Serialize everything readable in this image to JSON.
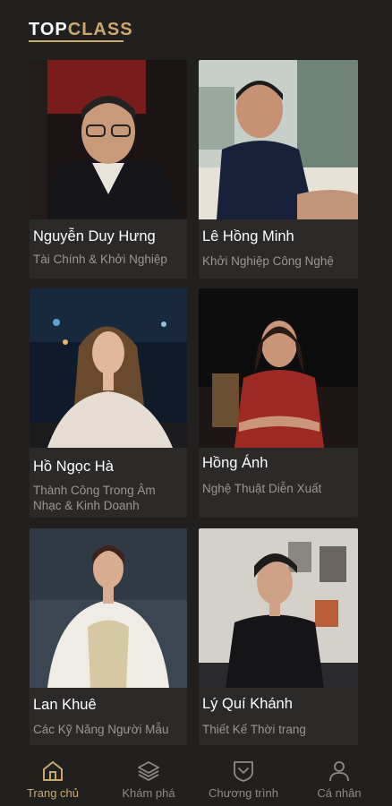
{
  "brand": {
    "logo_top": "TOP",
    "logo_class": "CLASS"
  },
  "cards": [
    {
      "name": "Nguyễn Duy Hưng",
      "topic": "Tài Chính & Khởi Nghiệp"
    },
    {
      "name": "Lê Hồng Minh",
      "topic": "Khởi Nghiệp  Công Nghệ"
    },
    {
      "name": "Hồ Ngọc Hà",
      "topic": "Thành Công Trong Âm Nhạc & Kinh Doanh"
    },
    {
      "name": "Hồng Ánh",
      "topic": "Nghệ Thuật Diễn Xuất"
    },
    {
      "name": "Lan Khuê",
      "topic": "Các Kỹ Năng Người Mẫu"
    },
    {
      "name": "Lý Quí Khánh",
      "topic": "Thiết Kế Thời trang"
    }
  ],
  "tabs": [
    {
      "label": "Trang chủ",
      "icon": "home-icon",
      "active": true
    },
    {
      "label": "Khám phá",
      "icon": "layers-icon",
      "active": false
    },
    {
      "label": "Chương trình",
      "icon": "shield-chevron-icon",
      "active": false
    },
    {
      "label": "Cá nhân",
      "icon": "user-icon",
      "active": false
    }
  ],
  "colors": {
    "accent": "#c9a96e",
    "background": "#221f1f",
    "card": "#2c2929"
  }
}
